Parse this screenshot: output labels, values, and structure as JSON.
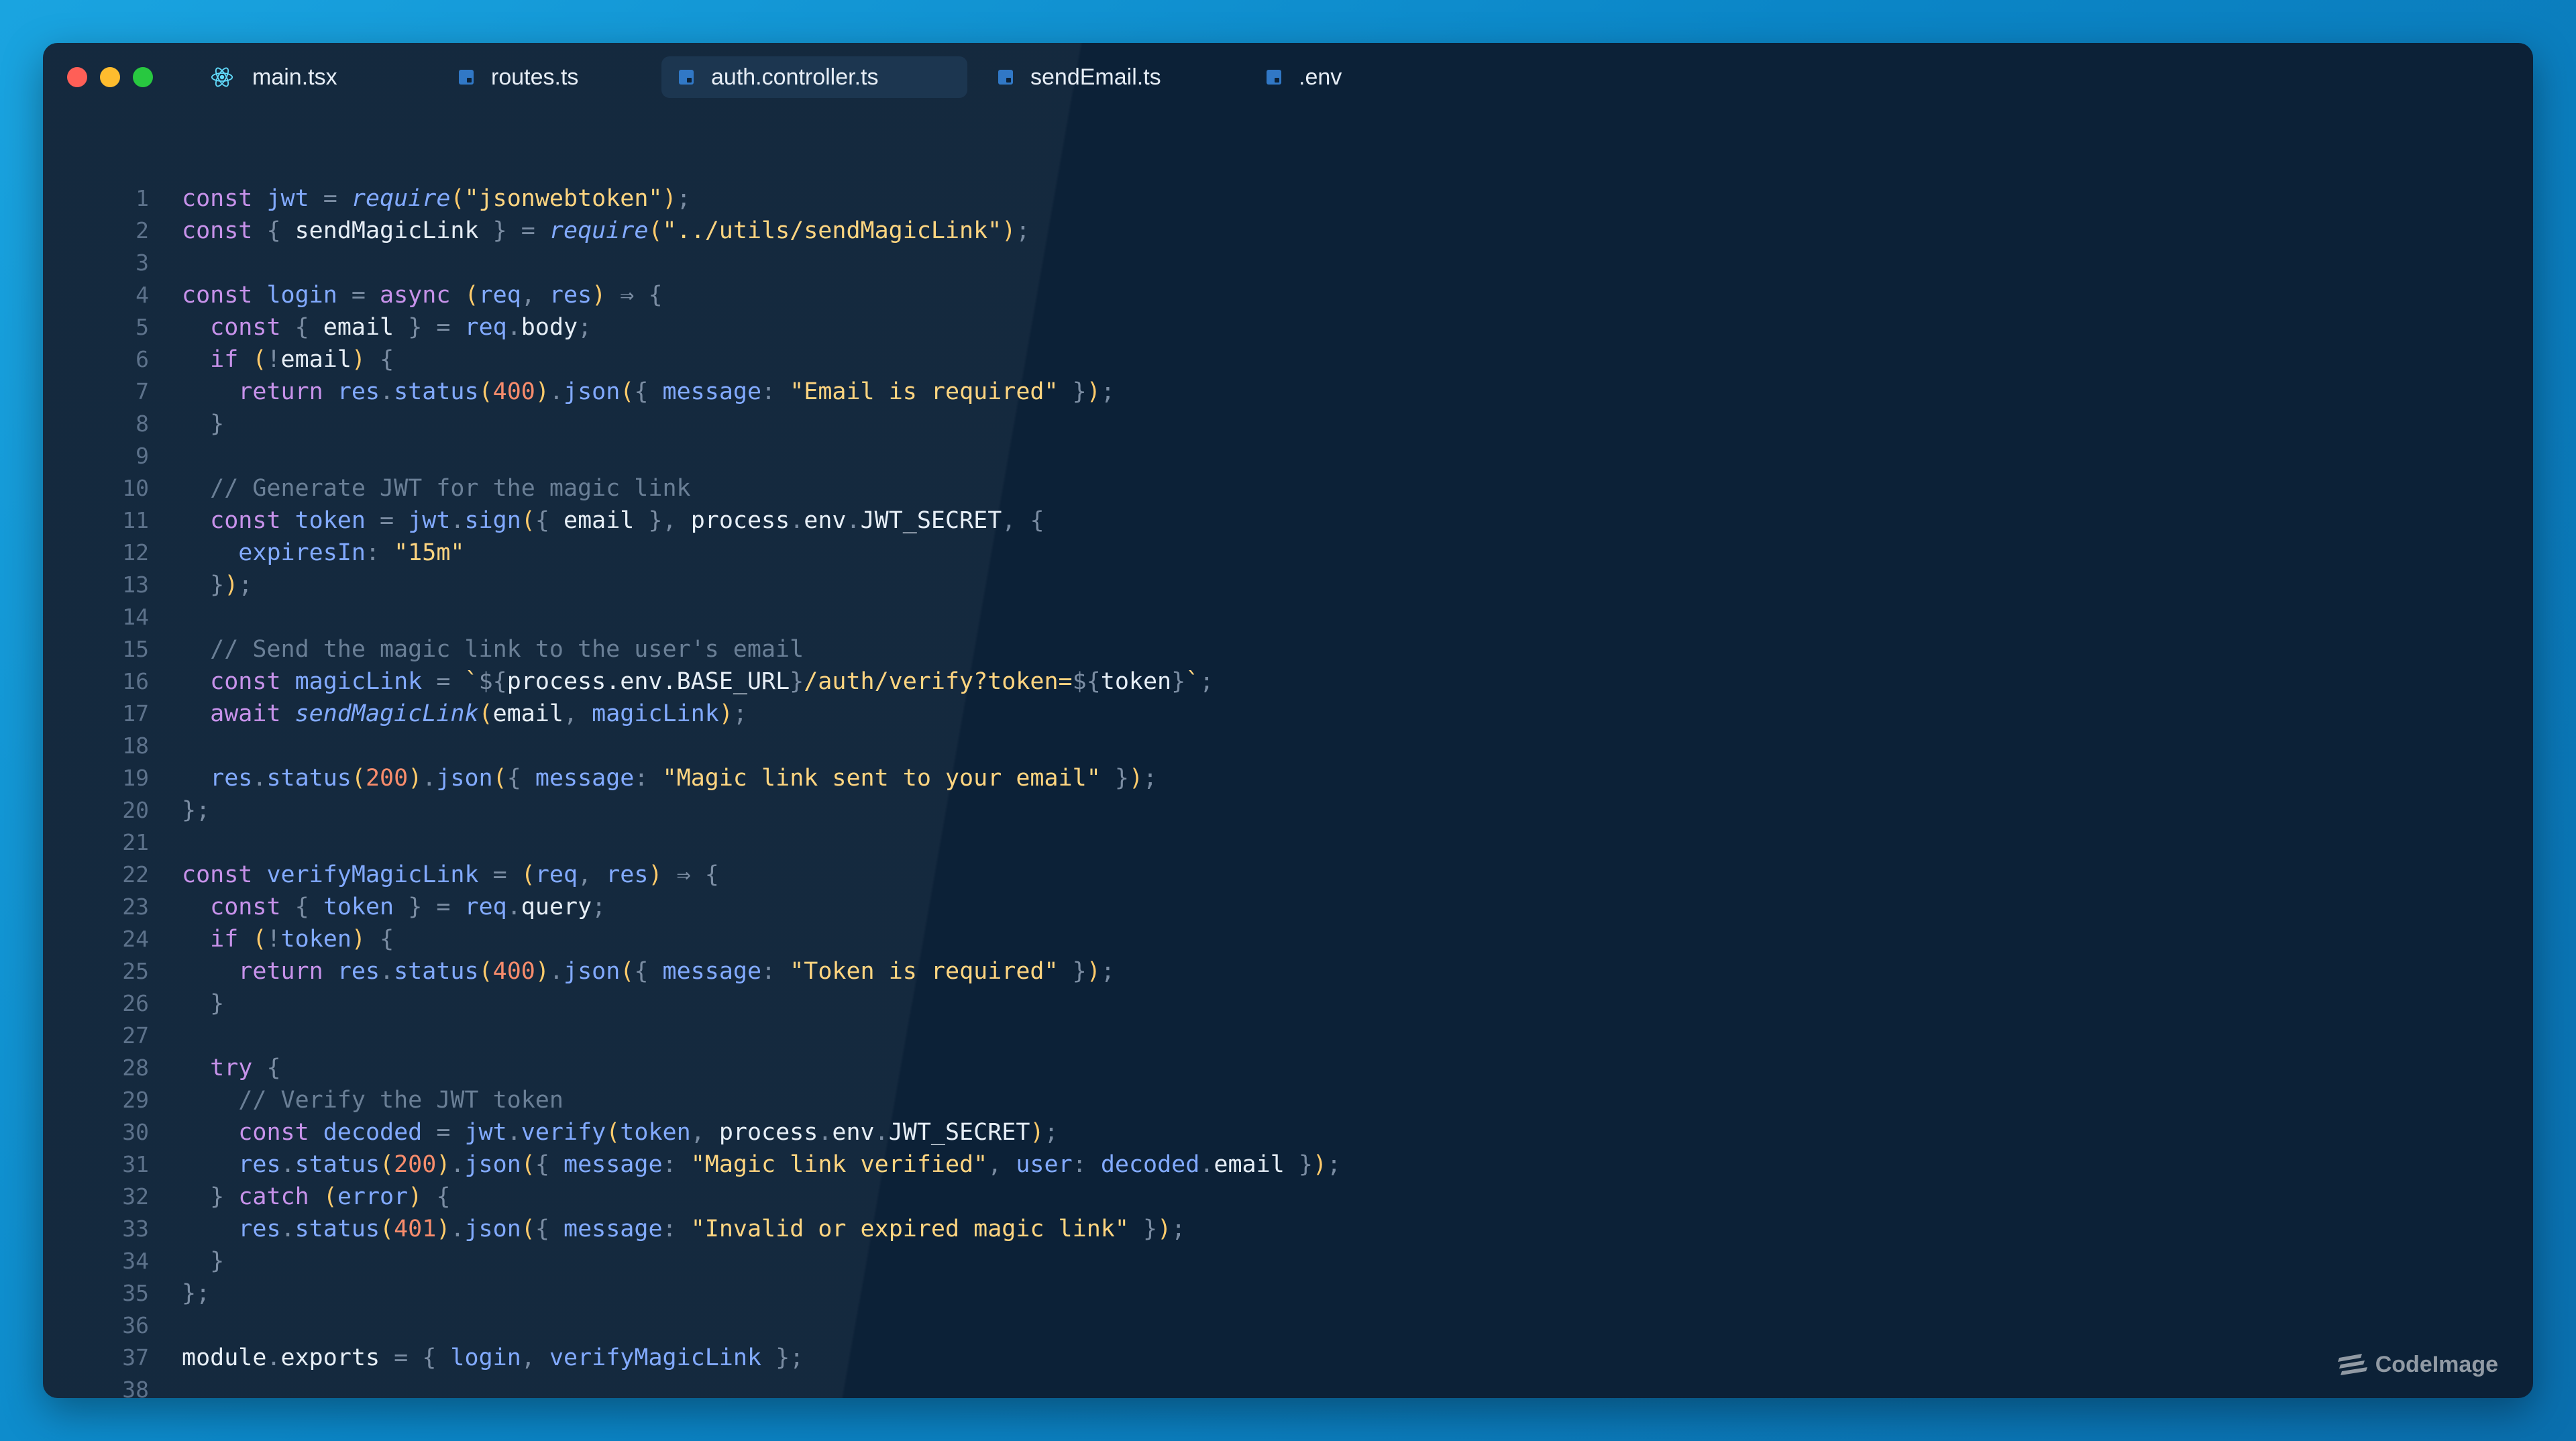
{
  "tabs": [
    {
      "label": "main.tsx",
      "icon": "react-icon",
      "active": false
    },
    {
      "label": "routes.ts",
      "icon": "typescript-file-icon",
      "active": false
    },
    {
      "label": "auth.controller.ts",
      "icon": "typescript-file-icon",
      "active": true
    },
    {
      "label": "sendEmail.ts",
      "icon": "typescript-file-icon",
      "active": false
    },
    {
      "label": ".env",
      "icon": "typescript-file-icon",
      "active": false
    }
  ],
  "code_lines": [
    "const jwt = require(\"jsonwebtoken\");",
    "const { sendMagicLink } = require(\"../utils/sendMagicLink\");",
    "",
    "const login = async (req, res) ⇒ {",
    "  const { email } = req.body;",
    "  if (!email) {",
    "    return res.status(400).json({ message: \"Email is required\" });",
    "  }",
    "",
    "  // Generate JWT for the magic link",
    "  const token = jwt.sign({ email }, process.env.JWT_SECRET, {",
    "    expiresIn: \"15m\"",
    "  });",
    "",
    "  // Send the magic link to the user's email",
    "  const magicLink = `${process.env.BASE_URL}/auth/verify?token=${token}`;",
    "  await sendMagicLink(email, magicLink);",
    "",
    "  res.status(200).json({ message: \"Magic link sent to your email\" });",
    "};",
    "",
    "const verifyMagicLink = (req, res) ⇒ {",
    "  const { token } = req.query;",
    "  if (!token) {",
    "    return res.status(400).json({ message: \"Token is required\" });",
    "  }",
    "",
    "  try {",
    "    // Verify the JWT token",
    "    const decoded = jwt.verify(token, process.env.JWT_SECRET);",
    "    res.status(200).json({ message: \"Magic link verified\", user: decoded.email });",
    "  } catch (error) {",
    "    res.status(401).json({ message: \"Invalid or expired magic link\" });",
    "  }",
    "};",
    "",
    "module.exports = { login, verifyMagicLink };",
    ""
  ],
  "brand": {
    "label": "CodeImage",
    "icon": "codeimage-logo-icon"
  },
  "colors": {
    "background_gradient_start": "#1aa4e0",
    "editor_background": "#0c2137",
    "active_tab": "#1c3650",
    "keyword": "#c792ea",
    "string": "#ffd580",
    "number": "#f78c6c",
    "function": "#82aaff",
    "comment": "#6a7f96"
  }
}
